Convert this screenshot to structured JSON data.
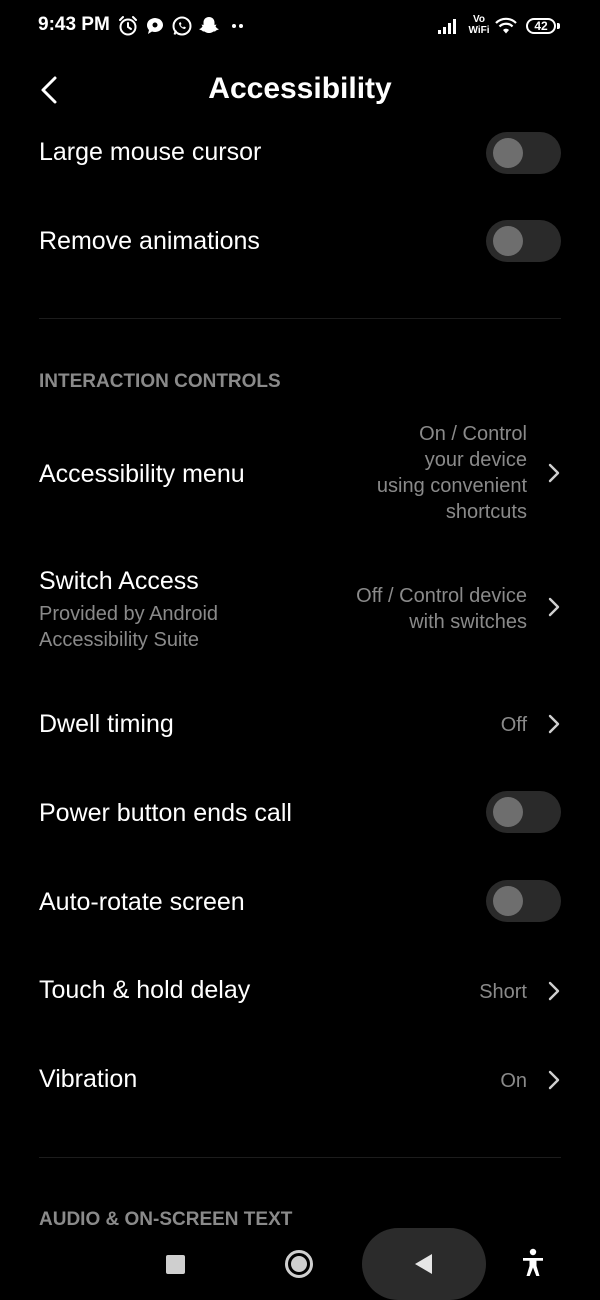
{
  "status_bar": {
    "time": "9:43 PM",
    "icons": [
      "alarm-icon",
      "chat-bubble-icon",
      "whatsapp-icon",
      "snapchat-icon",
      "more-dots-icon",
      "signal-icon",
      "vowifi-icon",
      "wifi-icon"
    ],
    "vowifi_top": "Vo",
    "vowifi_bottom": "WiFi",
    "battery": "42"
  },
  "header": {
    "title": "Accessibility",
    "back_icon": "back-arrow-icon"
  },
  "rows_top": [
    {
      "title": "Large mouse cursor",
      "toggle": false
    },
    {
      "title": "Remove animations",
      "toggle": false
    }
  ],
  "section_interaction": {
    "label": "INTERACTION CONTROLS"
  },
  "rows": {
    "accessibility_menu": {
      "title": "Accessibility menu",
      "value_lines": [
        "On / Control",
        "your device",
        "using convenient",
        "shortcuts"
      ]
    },
    "switch_access": {
      "title": "Switch Access",
      "subtitle_lines": [
        "Provided by Android",
        "Accessibility Suite"
      ],
      "value_lines": [
        "Off / Control device",
        "with switches"
      ]
    },
    "dwell_timing": {
      "title": "Dwell timing",
      "value": "Off"
    },
    "power_button": {
      "title": "Power button ends call",
      "toggle": false
    },
    "auto_rotate": {
      "title": "Auto-rotate screen",
      "toggle": false
    },
    "touch_hold": {
      "title": "Touch & hold delay",
      "value": "Short"
    },
    "vibration": {
      "title": "Vibration",
      "value": "On"
    }
  },
  "section_audio": {
    "label": "AUDIO & ON-SCREEN TEXT"
  },
  "nav_bar": {
    "buttons": [
      "recents-icon",
      "home-icon",
      "back-icon",
      "accessibility-shortcut-icon"
    ]
  },
  "colors": {
    "background": "#000000",
    "text_primary": "#ffffff",
    "text_secondary": "#8a8a8a",
    "toggle_track": "#2a2a2a",
    "toggle_knob": "#6e6e6e"
  }
}
